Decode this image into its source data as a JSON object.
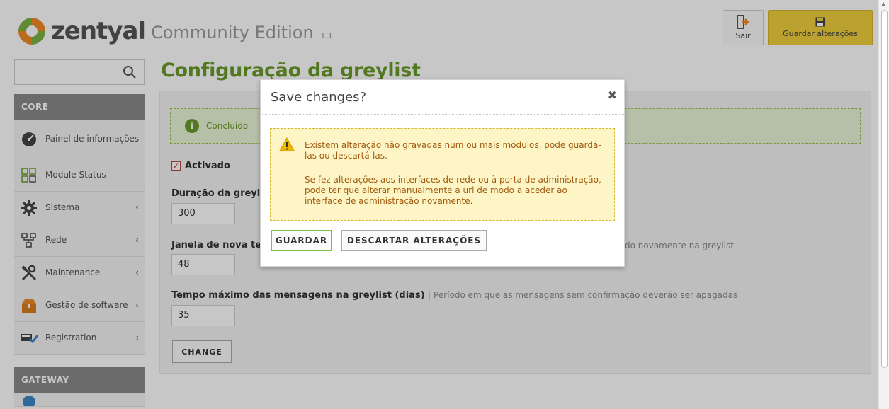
{
  "header": {
    "brand": "zentyal",
    "edition": "Community Edition",
    "version": "3.3",
    "logout_label": "Sair",
    "save_label": "Guardar alterações"
  },
  "sidebar": {
    "search_placeholder": "",
    "sections": [
      {
        "title": "CORE",
        "items": [
          {
            "label": "Painel de informações",
            "icon": "dashboard-icon",
            "has_submenu": false
          },
          {
            "label": "Module Status",
            "icon": "module-status-icon",
            "has_submenu": false
          },
          {
            "label": "Sistema",
            "icon": "gear-icon",
            "has_submenu": true
          },
          {
            "label": "Rede",
            "icon": "network-icon",
            "has_submenu": true
          },
          {
            "label": "Maintenance",
            "icon": "tools-icon",
            "has_submenu": true
          },
          {
            "label": "Gestão de software",
            "icon": "package-icon",
            "has_submenu": true
          },
          {
            "label": "Registration",
            "icon": "registration-icon",
            "has_submenu": true
          }
        ]
      },
      {
        "title": "GATEWAY",
        "items": []
      }
    ]
  },
  "main": {
    "page_title": "Configuração da greylist",
    "success_message": "Concluído",
    "enabled_label": "Activado",
    "enabled": true,
    "fields": [
      {
        "label": "Duração da greylis",
        "hint": "",
        "value": "300"
      },
      {
        "label": "Janela de nova ter",
        "hint": "do novamente na greylist",
        "value": "48"
      },
      {
        "label": "Tempo máximo das mensagens na greylist (dias)",
        "hint": "Período em que as mensagens sem confirmação deverão ser apagadas",
        "value": "35"
      }
    ],
    "change_label": "CHANGE"
  },
  "dialog": {
    "title": "Save changes?",
    "close_symbol": "✖",
    "warning_line1": "Existem alteração não gravadas num ou mais módulos, pode guardá-las ou descartá-las.",
    "warning_line2": "Se fez alterações aos interfaces de rede ou à porta de administração, pode ter que alterar manualmente a url de modo a aceder ao interface de administração novamente.",
    "save_button": "GUARDAR",
    "discard_button": "DESCARTAR ALTERAÇÕES"
  },
  "colors": {
    "brand_orange": "#f08a24",
    "brand_green": "#6a9a2a",
    "save_yellow": "#f0cf3c",
    "warning_text": "#a25b0f"
  }
}
